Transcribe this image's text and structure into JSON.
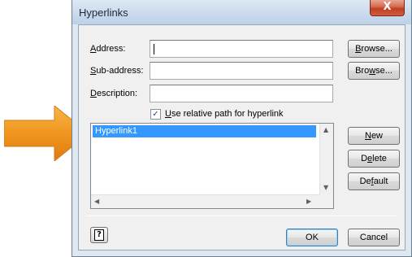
{
  "dialog": {
    "title": "Hyperlinks",
    "close_glyph": "X"
  },
  "form": {
    "address_label": "Address:",
    "address_value": "",
    "subaddress_label": "Sub-address:",
    "subaddress_value": "",
    "description_label": "Description:",
    "description_value": "",
    "browse_address_label": "Browse...",
    "browse_subaddress_label": "Browse...",
    "relative_path_label": "Use relative path for hyperlink",
    "relative_path_checked": true
  },
  "hyperlinks_list": {
    "items": [
      "Hyperlink1"
    ],
    "selected_index": 0
  },
  "side_buttons": {
    "new_label": "New",
    "delete_label": "Delete",
    "default_label": "Default"
  },
  "footer": {
    "ok_label": "OK",
    "cancel_label": "Cancel",
    "help_glyph": "?"
  },
  "colors": {
    "arrow": "#f0961e",
    "selection": "#3399ff"
  }
}
